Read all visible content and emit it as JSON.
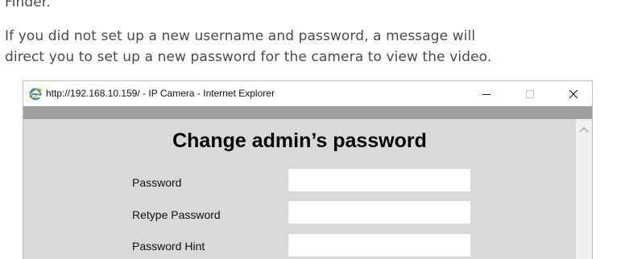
{
  "document": {
    "lines": [
      "Finder.",
      "If you did not set up a new username and password, a message will",
      "direct you to set up a new password for the camera to view the video."
    ]
  },
  "browser_window": {
    "title": "http://192.168.10.159/ - IP Camera - Internet Explorer",
    "icon": "internet-explorer-icon",
    "controls": [
      "minimize-icon",
      "maximize-icon",
      "close-icon"
    ]
  },
  "form": {
    "heading": "Change admin’s password",
    "fields": [
      {
        "label": "Password",
        "value": ""
      },
      {
        "label": "Retype Password",
        "value": ""
      },
      {
        "label": "Password Hint",
        "value": ""
      }
    ]
  },
  "colors": {
    "page_background": "#d9d9d9",
    "top_strip": "#9e9e9e",
    "ie_blue": "#1e88e5",
    "ie_ring": "#f5b400"
  }
}
